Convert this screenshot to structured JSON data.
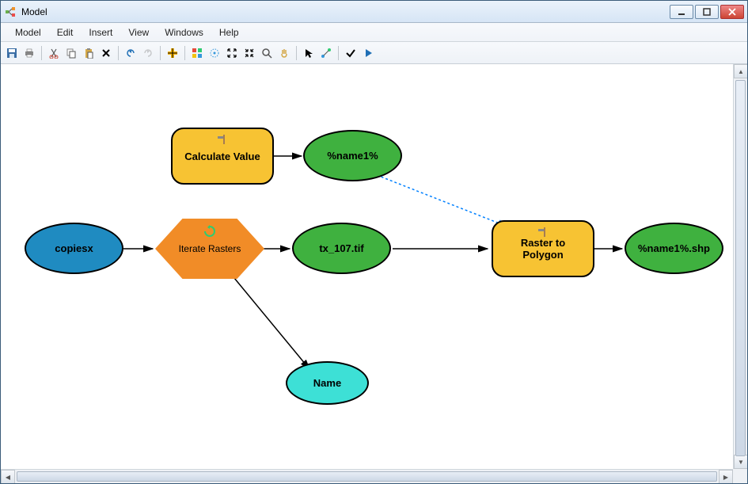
{
  "window": {
    "title": "Model"
  },
  "menu": {
    "items": [
      "Model",
      "Edit",
      "Insert",
      "View",
      "Windows",
      "Help"
    ]
  },
  "toolbar_icons": {
    "save": "save-icon",
    "print": "print-icon",
    "cut": "cut-icon",
    "copy": "copy-icon",
    "paste": "paste-icon",
    "delete": "delete-icon",
    "undo": "undo-icon",
    "redo": "redo-icon",
    "pan": "pan-icon",
    "grid": "grid-icon",
    "full_extent": "full-extent-icon",
    "zoom_in": "zoom-in-icon",
    "zoom_out": "zoom-out-icon",
    "zoom": "zoom-icon",
    "hand": "hand-icon",
    "select": "select-icon",
    "connect": "connect-icon",
    "validate": "validate-icon",
    "run": "run-icon"
  },
  "nodes": {
    "copiesx": {
      "label": "copiesx"
    },
    "iterate": {
      "label": "Iterate Rasters"
    },
    "calc_value": {
      "label": "Calculate Value"
    },
    "name1_var": {
      "label": "%name1%"
    },
    "tx107": {
      "label": "tx_107.tif"
    },
    "raster_poly": {
      "label": "Raster to Polygon"
    },
    "name1_shp": {
      "label": "%name1%.shp"
    },
    "name": {
      "label": "Name"
    }
  }
}
